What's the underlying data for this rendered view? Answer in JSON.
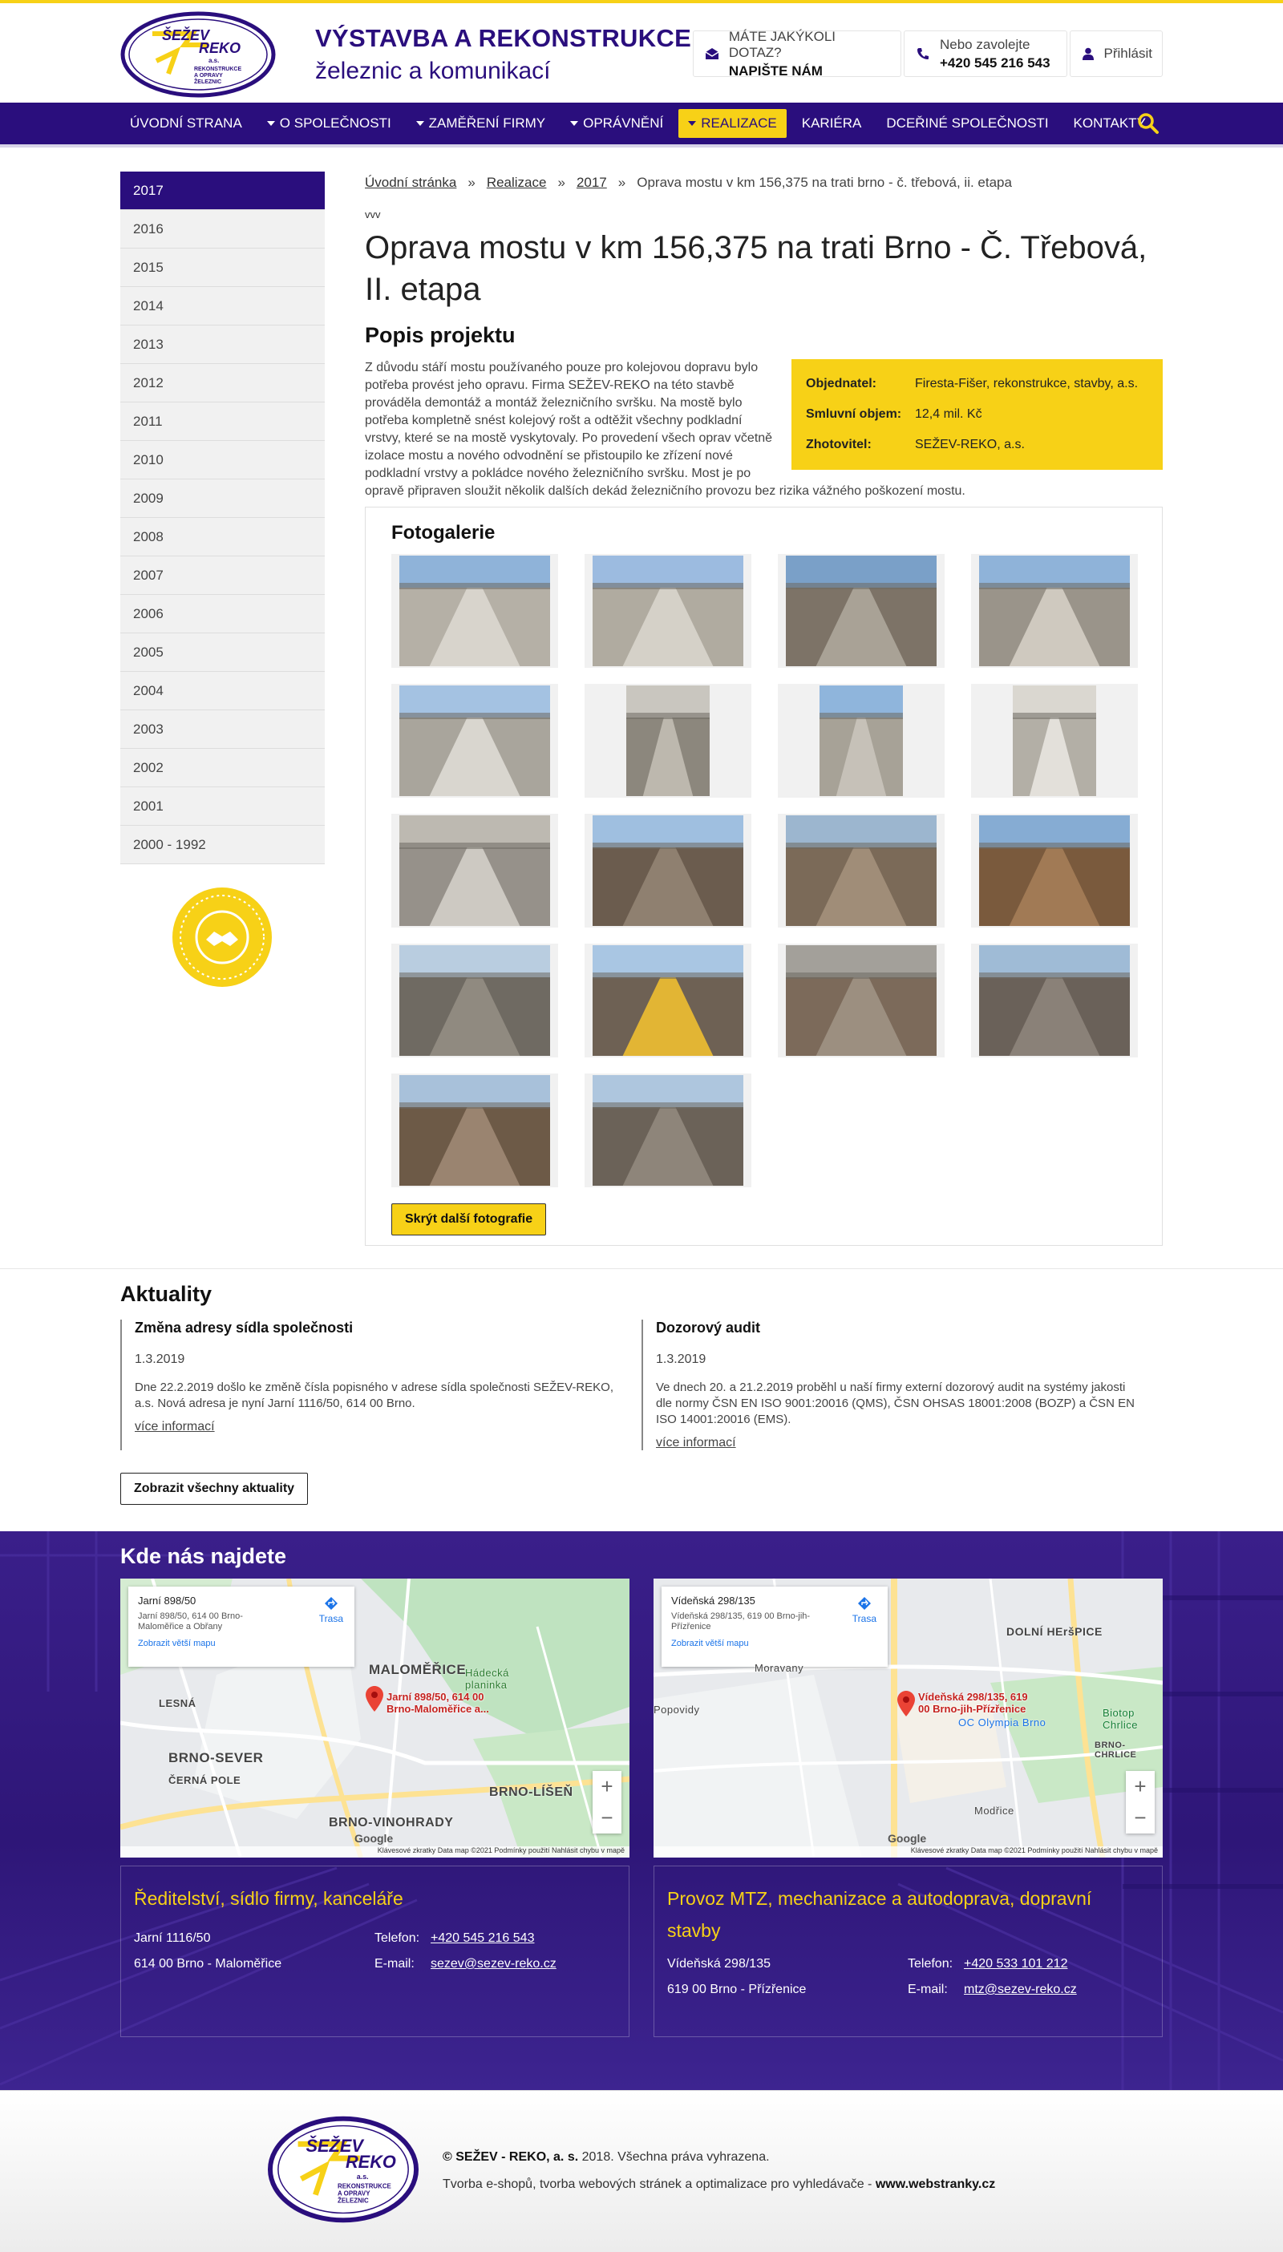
{
  "header": {
    "logo_text": "ŠEŽEV REKO a.s. REKONSTRUKCE A OPRAVY ŽELEZNIC",
    "brand_line1": "VÝSTAVBA A REKONSTRUKCE",
    "brand_line2": "železnic a komunikací",
    "question_label": "MÁTE JAKÝKOLI DOTAZ?",
    "question_cta": "NAPIŠTE NÁM",
    "call_label": "Nebo zavolejte",
    "call_number": "+420 545 216 543",
    "login": "Přihlásit"
  },
  "nav": {
    "items": [
      {
        "label": "ÚVODNÍ STRANA",
        "dropdown": false
      },
      {
        "label": "O SPOLEČNOSTI",
        "dropdown": true
      },
      {
        "label": "ZAMĚŘENÍ FIRMY",
        "dropdown": true
      },
      {
        "label": "OPRÁVNĚNÍ",
        "dropdown": true
      },
      {
        "label": "REALIZACE",
        "dropdown": true
      },
      {
        "label": "KARIÉRA",
        "dropdown": false
      },
      {
        "label": "DCEŘINÉ SPOLEČNOSTI",
        "dropdown": false
      },
      {
        "label": "KONTAKTY",
        "dropdown": false
      }
    ]
  },
  "years": [
    "2017",
    "2016",
    "2015",
    "2014",
    "2013",
    "2012",
    "2011",
    "2010",
    "2009",
    "2008",
    "2007",
    "2006",
    "2005",
    "2004",
    "2003",
    "2002",
    "2001",
    "2000 - 1992"
  ],
  "seal_text": "VYBÍREJ VYNIKAJÍCÍ · OVĚŘENÁ FIRMA",
  "breadcrumb": [
    "Úvodní stránka",
    "Realizace",
    "2017",
    "Oprava mostu v km 156,375 na trati brno - č. třebová, ii. etapa"
  ],
  "article": {
    "overline": "vvv",
    "title": "Oprava mostu v km 156,375 na trati Brno - Č. Třebová, II. etapa",
    "subtitle": "Popis projektu",
    "description": "Z důvodu stáří mostu používaného pouze pro kolejovou dopravu bylo potřeba provést jeho opravu. Firma SEŽEV-REKO na této stavbě prováděla demontáž a montáž železničního svršku. Na mostě bylo potřeba kompletně snést kolejový rošt a odtěžit všechny podkladní vrstvy, které se na mostě vyskytovaly. Po provedení všech oprav včetně izolace mostu a nového odvodnění se přistoupilo ke zřízení nové podkladní vrstvy a pokládce nového železničního svršku. Most je po opravě připraven sloužit několik dalších dekád železničního provozu bez rizika vážného poškození mostu.",
    "info": [
      {
        "key": "Objednatel:",
        "value": "Firesta-Fišer, rekonstrukce, stavby, a.s."
      },
      {
        "key": "Smluvní objem:",
        "value": "12,4 mil. Kč"
      },
      {
        "key": "Zhotovitel:",
        "value": "SEŽEV-REKO, a.s."
      }
    ]
  },
  "gallery": {
    "title": "Fotogalerie",
    "hide_button": "Skrýt další fotografie"
  },
  "news": {
    "title": "Aktuality",
    "items": [
      {
        "title": "Změna adresy sídla společnosti",
        "date": "1.3.2019",
        "text": "Dne 22.2.2019 došlo ke změně čísla popisného v adrese sídla společnosti SEŽEV-REKO, a.s. Nová adresa je nyní Jarní 1116/50, 614 00 Brno.",
        "more": "více informací"
      },
      {
        "title": "Dozorový audit",
        "date": "1.3.2019",
        "text": "Ve dnech 20. a 21.2.2019 proběhl u naší firmy externí dozorový audit na systémy jakosti dle normy ČSN EN ISO 9001:20016 (QMS), ČSN OHSAS 18001:2008 (BOZP) a ČSN EN ISO 14001:20016 (EMS).",
        "more": "více informací"
      }
    ],
    "all_button": "Zobrazit všechny aktuality"
  },
  "locations": {
    "title": "Kde nás najdete",
    "places": [
      {
        "map_title": "Jarní 898/50",
        "map_sub": "Jarní 898/50, 614 00 Brno-Maloměřice a Obřany",
        "map_big": "Zobrazit větší mapu",
        "route": "Trasa",
        "pin_label": "Jarní 898/50, 614 00 Brno-Maloměřice a...",
        "labels": [
          "MALOMĚŘICE",
          "BRNO-SEVER",
          "BRNO-VINOHRADY",
          "BRNO-LÍŠEŇ",
          "ČERNÁ POLE",
          "LESNÁ",
          "Hádecká planinka"
        ],
        "footer": "Klávesové zkratky   Data map ©2021   Podmínky použití   Nahlásit chybu v mapě",
        "heading": "Ředitelství, sídlo firmy, kanceláře",
        "street": "Jarní 1116/50",
        "city": "614 00 Brno - Maloměřice",
        "phone_label": "Telefon:",
        "phone": "+420 545 216 543",
        "email_label": "E-mail:",
        "email": "sezev@sezev-reko.cz"
      },
      {
        "map_title": "Vídeňská 298/135",
        "map_sub": "Vídeňská 298/135, 619 00 Brno-jih-Přízřenice",
        "map_big": "Zobrazit větší mapu",
        "route": "Trasa",
        "pin_label": "Vídeňská 298/135, 619 00 Brno-jih-Přízřenice",
        "labels": [
          "DOLNÍ HEršPICE",
          "Moravany",
          "Modřice",
          "OC Olympia Brno",
          "Biotop Chrlice",
          "BRNO-CHRLICE",
          "Popovidy"
        ],
        "footer": "Klávesové zkratky   Data map ©2021   Podmínky použití   Nahlásit chybu v mapě",
        "heading": "Provoz MTZ, mechanizace a autodoprava, dopravní stavby",
        "street": "Vídeňská 298/135",
        "city": "619 00 Brno - Přízřenice",
        "phone_label": "Telefon:",
        "phone": "+420 533 101 212",
        "email_label": "E-mail:",
        "email": "mtz@sezev-reko.cz"
      }
    ],
    "google": "Google"
  },
  "footer": {
    "copyright_company": "© SEŽEV - REKO, a. s.",
    "copyright_rest": " 2018. Všechna práva vyhrazena.",
    "credits": "Tvorba e-shopů, tvorba webových stránek a optimalizace pro vyhledávače - ",
    "credits_link": "www.webstranky.cz"
  },
  "colors": {
    "brand": "#2a0e7d",
    "accent": "#f7d117"
  }
}
